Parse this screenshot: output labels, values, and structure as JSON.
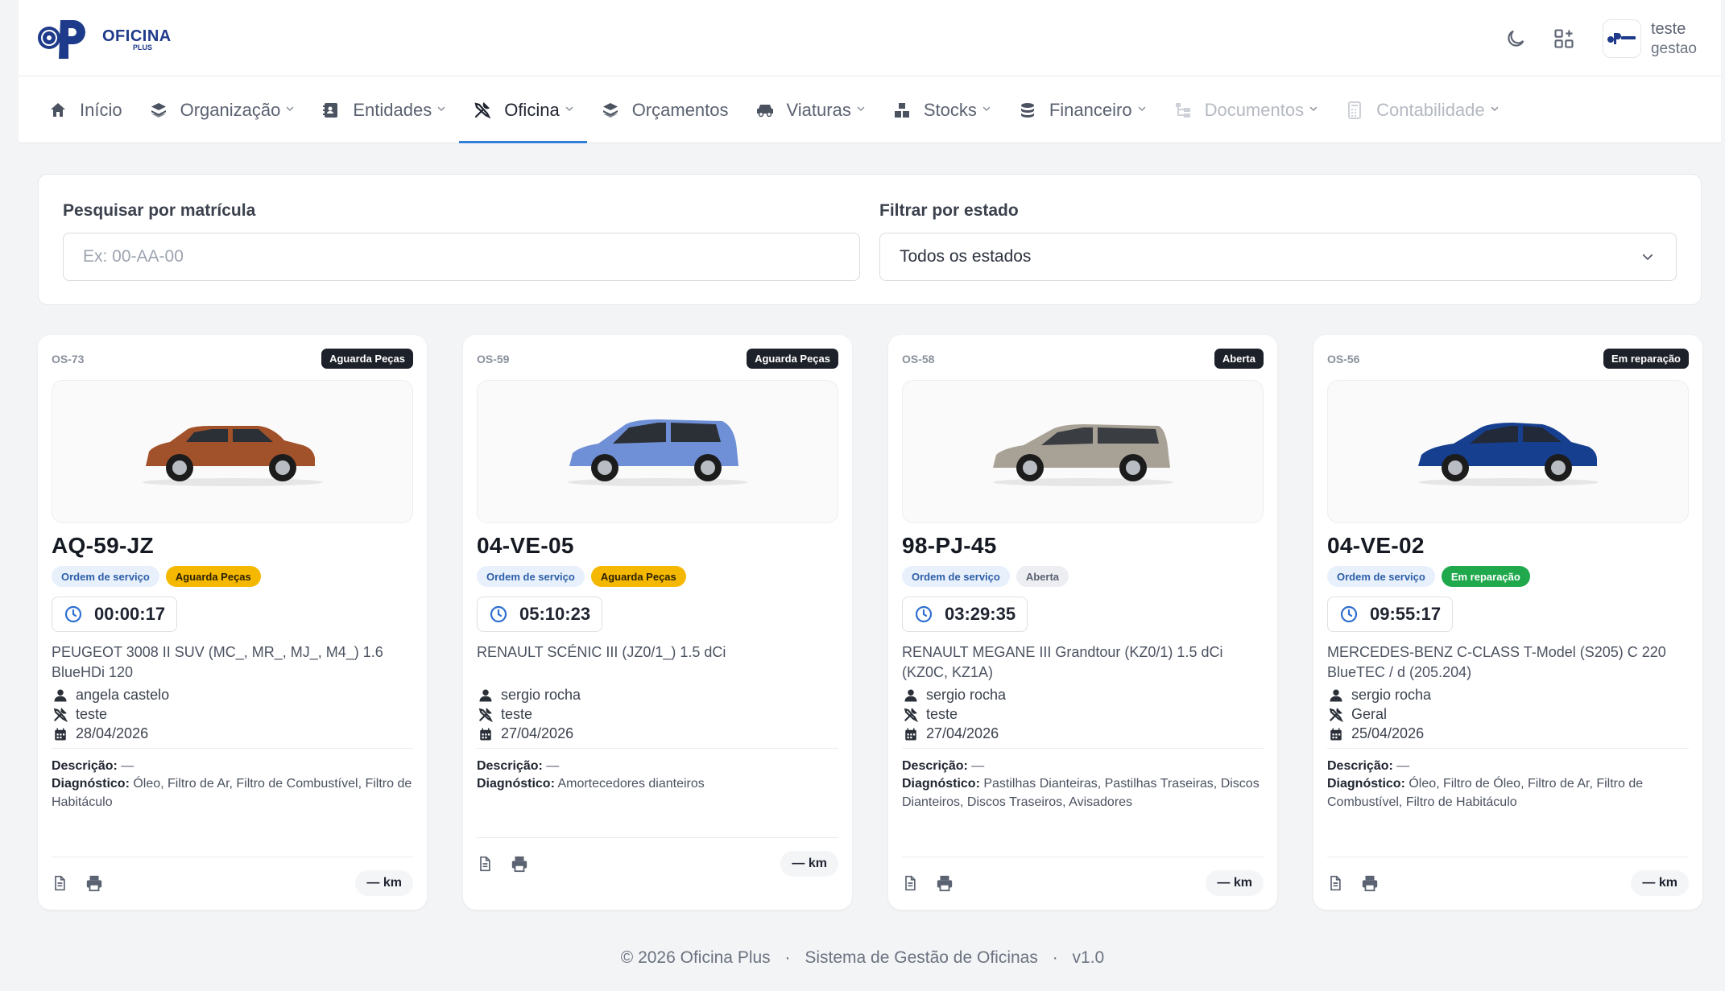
{
  "brand": {
    "name": "OFICINA",
    "sub": "PLUS",
    "primary": "#1e3a8a",
    "accent": "#2f7fd8"
  },
  "header": {
    "icons": [
      "moon-icon",
      "grid-add-icon"
    ],
    "user": {
      "name": "teste",
      "role": "gestao"
    }
  },
  "nav": [
    {
      "label": "Início",
      "icon": "home-icon",
      "dropdown": false,
      "state": "normal"
    },
    {
      "label": "Organização",
      "icon": "layers-icon",
      "dropdown": true,
      "state": "normal"
    },
    {
      "label": "Entidades",
      "icon": "id-card-icon",
      "dropdown": true,
      "state": "normal"
    },
    {
      "label": "Oficina",
      "icon": "tools-icon",
      "dropdown": true,
      "state": "active"
    },
    {
      "label": "Orçamentos",
      "icon": "layers-icon",
      "dropdown": false,
      "state": "normal"
    },
    {
      "label": "Viaturas",
      "icon": "car-icon",
      "dropdown": true,
      "state": "normal"
    },
    {
      "label": "Stocks",
      "icon": "boxes-icon",
      "dropdown": true,
      "state": "normal"
    },
    {
      "label": "Financeiro",
      "icon": "coins-icon",
      "dropdown": true,
      "state": "normal"
    },
    {
      "label": "Documentos",
      "icon": "sitemap-icon",
      "dropdown": true,
      "state": "disabled"
    },
    {
      "label": "Contabilidade",
      "icon": "calculator-icon",
      "dropdown": true,
      "state": "disabled"
    }
  ],
  "filters": {
    "search_label": "Pesquisar por matrícula",
    "search_placeholder": "Ex: 00-AA-00",
    "state_label": "Filtrar por estado",
    "state_value": "Todos os estados"
  },
  "cards": [
    {
      "os": "OS-73",
      "status": "Aguarda Peças",
      "status_kind": "wait",
      "plate": "AQ-59-JZ",
      "type_badge": "Ordem de serviço",
      "timer": "00:00:17",
      "model": "PEUGEOT 3008 II SUV (MC_, MR_, MJ_, M4_) 1.6 BlueHDi 120",
      "client": "angela castelo",
      "mechanic": "teste",
      "date": "28/04/2026",
      "desc_label": "Descrição:",
      "desc": "—",
      "diag_label": "Diagnóstico:",
      "diag": "Óleo, Filtro de Ar, Filtro de Combustível, Filtro de Habitáculo",
      "km": "— km",
      "car_color": "#a2522a"
    },
    {
      "os": "OS-59",
      "status": "Aguarda Peças",
      "status_kind": "wait",
      "plate": "04-VE-05",
      "type_badge": "Ordem de serviço",
      "timer": "05:10:23",
      "model": "RENAULT SCÉNIC III (JZ0/1_) 1.5 dCi",
      "client": "sergio rocha",
      "mechanic": "teste",
      "date": "27/04/2026",
      "desc_label": "Descrição:",
      "desc": "—",
      "diag_label": "Diagnóstico:",
      "diag": "Amortecedores dianteiros",
      "km": "— km",
      "car_color": "#6f8fd6"
    },
    {
      "os": "OS-58",
      "status": "Aberta",
      "status_kind": "open",
      "plate": "98-PJ-45",
      "type_badge": "Ordem de serviço",
      "timer": "03:29:35",
      "model": "RENAULT MEGANE III Grandtour (KZ0/1) 1.5 dCi (KZ0C, KZ1A)",
      "client": "sergio rocha",
      "mechanic": "teste",
      "date": "27/04/2026",
      "desc_label": "Descrição:",
      "desc": "—",
      "diag_label": "Diagnóstico:",
      "diag": "Pastilhas Dianteiras, Pastilhas Traseiras, Discos Dianteiros, Discos Traseiros, Avisadores",
      "km": "— km",
      "car_color": "#a8a195"
    },
    {
      "os": "OS-56",
      "status": "Em reparação",
      "status_kind": "repair",
      "plate": "04-VE-02",
      "type_badge": "Ordem de serviço",
      "timer": "09:55:17",
      "model": "MERCEDES-BENZ C-CLASS T-Model (S205) C 220 BlueTEC / d (205.204)",
      "client": "sergio rocha",
      "mechanic": "Geral",
      "date": "25/04/2026",
      "desc_label": "Descrição:",
      "desc": "—",
      "diag_label": "Diagnóstico:",
      "diag": "Óleo, Filtro de Óleo, Filtro de Ar, Filtro de Combustível, Filtro de Habitáculo",
      "km": "— km",
      "car_color": "#173f8f"
    }
  ],
  "footer": {
    "copyright": "© 2026 Oficina Plus",
    "system": "Sistema de Gestão de Oficinas",
    "version": "v1.0",
    "dot": "·"
  }
}
